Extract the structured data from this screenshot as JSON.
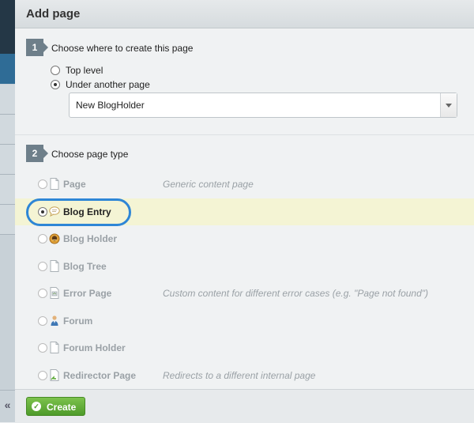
{
  "dialog": {
    "title": "Add page"
  },
  "step1": {
    "number": "1",
    "label": "Choose where to create this page",
    "options": [
      {
        "label": "Top level",
        "checked": false
      },
      {
        "label": "Under another page",
        "checked": true
      }
    ],
    "parent_page": "New BlogHolder"
  },
  "step2": {
    "number": "2",
    "label": "Choose page type",
    "types": [
      {
        "name": "Page",
        "description": "Generic content page",
        "icon": "page-icon",
        "selected": false
      },
      {
        "name": "Blog Entry",
        "description": "",
        "icon": "speech-bubble-icon",
        "selected": true
      },
      {
        "name": "Blog Holder",
        "description": "",
        "icon": "blog-holder-icon",
        "selected": false
      },
      {
        "name": "Blog Tree",
        "description": "",
        "icon": "page-icon",
        "selected": false
      },
      {
        "name": "Error Page",
        "description": "Custom content for different error cases (e.g. \"Page not found\")",
        "icon": "error-page-icon",
        "selected": false
      },
      {
        "name": "Forum",
        "description": "",
        "icon": "forum-user-icon",
        "selected": false
      },
      {
        "name": "Forum Holder",
        "description": "",
        "icon": "page-icon",
        "selected": false
      },
      {
        "name": "Redirector Page",
        "description": "Redirects to a different internal page",
        "icon": "redirector-page-icon",
        "selected": false
      }
    ]
  },
  "footer": {
    "create_label": "Create",
    "create_icon": "checkmark-icon"
  },
  "sidebar": {
    "collapse_glyph": "«"
  },
  "colors": {
    "accent": "#2e86d6",
    "create_green": "#5aa935",
    "selected_row": "#f4f4d4"
  }
}
